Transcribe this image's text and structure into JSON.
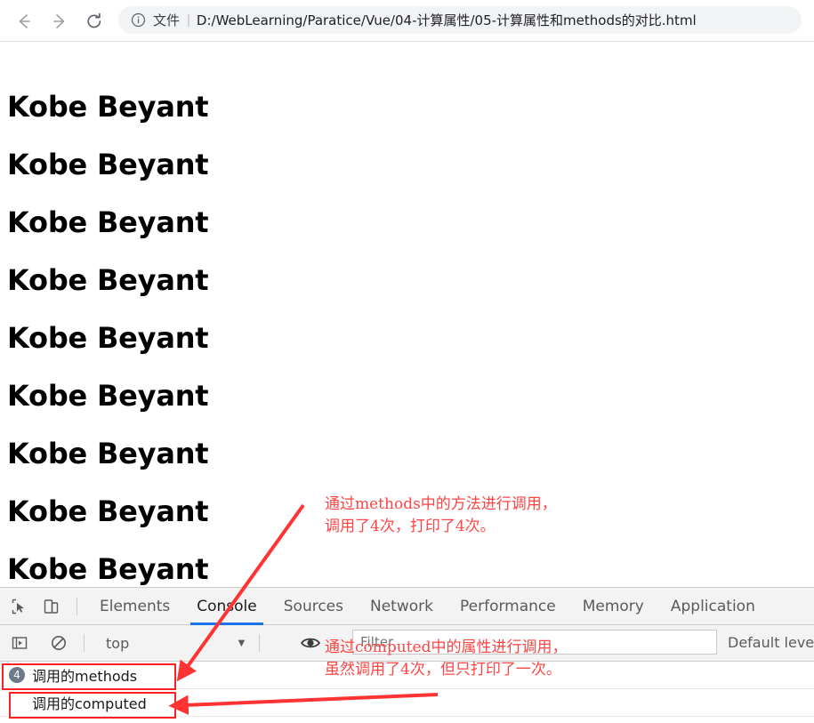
{
  "browser": {
    "back_icon": "arrow-left-icon",
    "forward_icon": "arrow-right-icon",
    "reload_icon": "reload-icon",
    "info_icon": "info-circle-icon",
    "scheme_label": "文件",
    "separator": "|",
    "url": "D:/WebLearning/Paratice/Vue/04-计算属性/05-计算属性和methods的对比.html"
  },
  "page": {
    "headings": [
      "Kobe Beyant",
      "Kobe Beyant",
      "Kobe Beyant",
      "Kobe Beyant",
      "Kobe Beyant",
      "Kobe Beyant",
      "Kobe Beyant",
      "Kobe Beyant",
      "Kobe Beyant"
    ]
  },
  "devtools": {
    "inspect_icon": "inspect-element-icon",
    "device_icon": "device-toolbar-icon",
    "tabs": [
      {
        "label": "Elements",
        "active": false
      },
      {
        "label": "Console",
        "active": true
      },
      {
        "label": "Sources",
        "active": false
      },
      {
        "label": "Network",
        "active": false
      },
      {
        "label": "Performance",
        "active": false
      },
      {
        "label": "Memory",
        "active": false
      },
      {
        "label": "Application",
        "active": false
      }
    ],
    "toolbar": {
      "sidebar_icon": "console-sidebar-icon",
      "clear_icon": "clear-console-icon",
      "context_value": "top",
      "context_caret": "▼",
      "eye_icon": "live-expression-eye-icon",
      "filter_placeholder": "Filter",
      "filter_value": "",
      "level_label": "Default leve"
    },
    "console_rows": [
      {
        "badge": "4",
        "message": "调用的methods",
        "indent": false
      },
      {
        "badge": "",
        "message": "调用的computed",
        "indent": true
      }
    ]
  },
  "annotations": {
    "methods_note_line1": "通过methods中的方法进行调用，",
    "methods_note_line2": "调用了4次，打印了4次。",
    "computed_note_line1": "通过computed中的属性进行调用，",
    "computed_note_line2": "虽然调用了4次，但只打印了一次。",
    "arrow_color": "#ff3333",
    "box_color": "#ff2222"
  }
}
